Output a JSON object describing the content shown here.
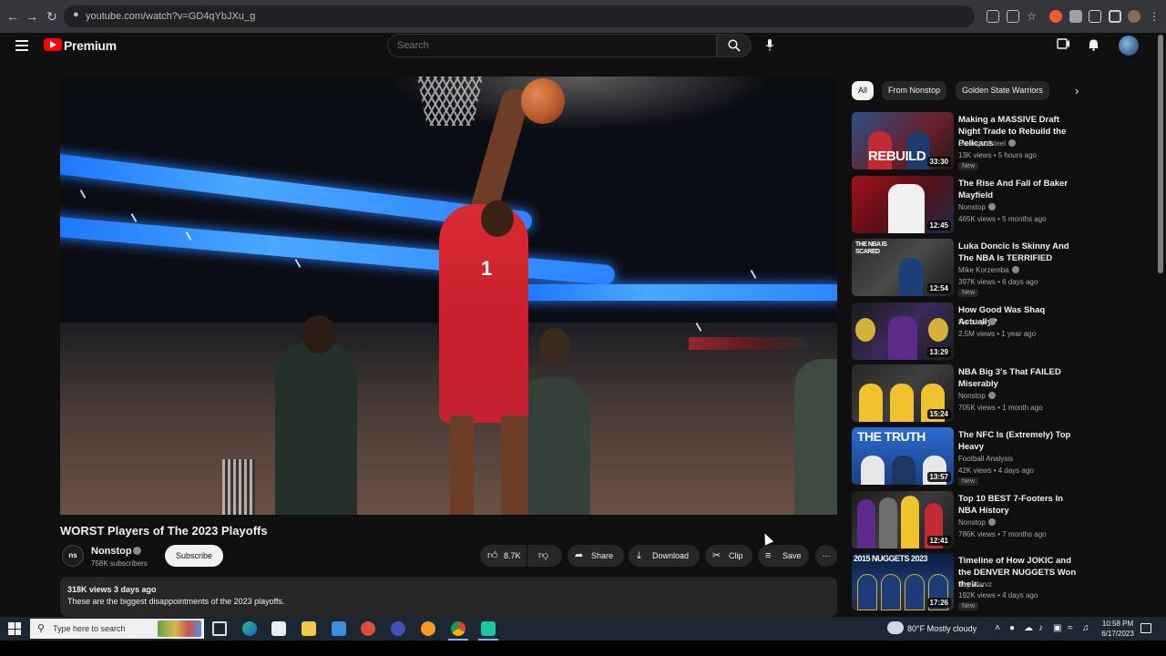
{
  "browser": {
    "url": "youtube.com/watch?v=GD4qYbJXu_g",
    "back_icon": "arrow-left-icon",
    "forward_icon": "arrow-right-icon",
    "reload_icon": "reload-icon"
  },
  "header": {
    "brand": "Premium",
    "search_placeholder": "Search"
  },
  "player": {
    "jersey_number": "1"
  },
  "video": {
    "title": "WORST Players of The 2023 Playoffs",
    "channel_avatar_text": "ns",
    "channel": "Nonstop",
    "subscribers": "758K subscribers",
    "subscribe_label": "Subscribe",
    "likes": "8.7K",
    "share_label": "Share",
    "download_label": "Download",
    "clip_label": "Clip",
    "save_label": "Save",
    "views_date": "318K views  3 days ago",
    "description": "These are the biggest disappointments of the 2023 playoffs."
  },
  "chips": [
    "All",
    "From Nonstop",
    "Golden State Warriors"
  ],
  "recommendations": [
    {
      "title": "Making a MASSIVE Draft Night Trade to Rebuild the Pelicans",
      "channel": "Sixringsofsteel",
      "meta": "13K views • 5 hours ago",
      "badge": "New",
      "duration": "33:30",
      "thumb_text": "REBUILD"
    },
    {
      "title": "The Rise And Fall of Baker Mayfield",
      "channel": "Nonstop",
      "meta": "465K views • 5 months ago",
      "badge": "",
      "duration": "12:45",
      "thumb_text": ""
    },
    {
      "title": "Luka Doncic Is Skinny And The NBA Is TERRIFIED",
      "channel": "Mike Korzemba",
      "meta": "397K views • 6 days ago",
      "badge": "New",
      "duration": "12:54",
      "thumb_text": "THE NBA IS SCARED"
    },
    {
      "title": "How Good Was Shaq Actually?",
      "channel": "Nonstop",
      "meta": "2.5M views • 1 year ago",
      "badge": "",
      "duration": "13:29",
      "thumb_text": ""
    },
    {
      "title": "NBA Big 3's That FAILED Miserably",
      "channel": "Nonstop",
      "meta": "705K views • 1 month ago",
      "badge": "",
      "duration": "15:24",
      "thumb_text": ""
    },
    {
      "title": "The NFC Is (Extremely) Top Heavy",
      "channel": "Football Analysis",
      "meta": "42K views • 4 days ago",
      "badge": "New",
      "duration": "13:57",
      "thumb_text": "THE TRUTH"
    },
    {
      "title": "Top 10 BEST 7-Footers In NBA History",
      "channel": "Nonstop",
      "meta": "786K views • 7 months ago",
      "badge": "",
      "duration": "12:41",
      "thumb_text": ""
    },
    {
      "title": "Timeline of How JOKIC and the DENVER NUGGETS Won their...",
      "channel": "Jay Warvz",
      "meta": "192K views • 4 days ago",
      "badge": "New",
      "duration": "17:26",
      "thumb_text": "2015 NUGGETS 2023"
    }
  ],
  "taskbar": {
    "search_placeholder": "Type here to search",
    "weather": "80°F  Mostly cloudy",
    "time": "10:58 PM",
    "date": "6/17/2023"
  },
  "colors": {
    "background": "#0f0f0f",
    "brand_red": "#ff0000",
    "chip_active": "#f1f1f1",
    "taskbar": "#1c2733"
  }
}
